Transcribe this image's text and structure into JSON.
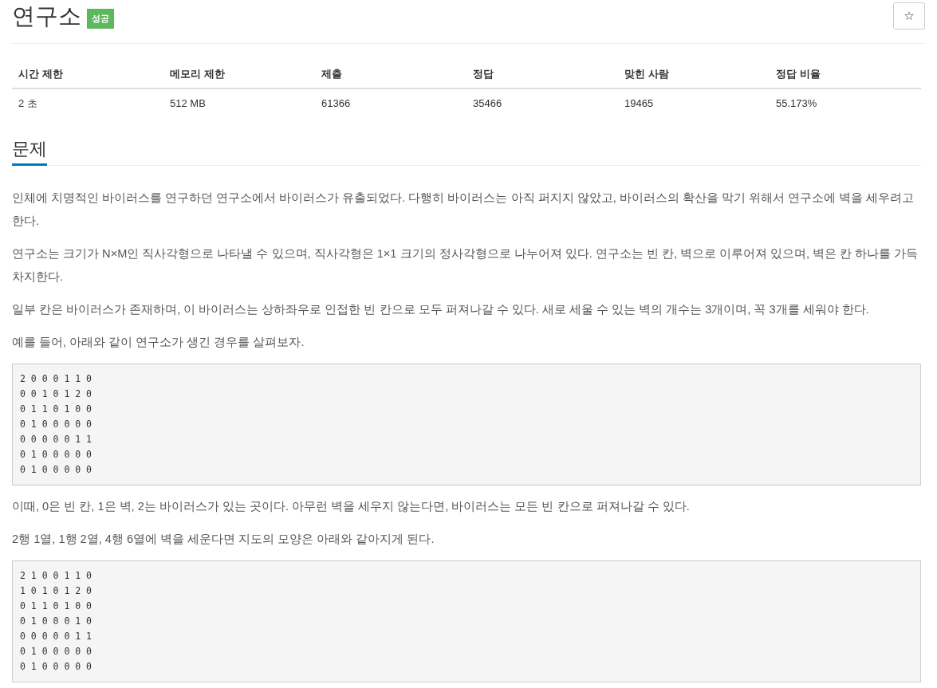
{
  "title": "연구소",
  "badge": "성공",
  "star_button": "☆",
  "info_table": {
    "columns": [
      "시간 제한",
      "메모리 제한",
      "제출",
      "정답",
      "맞힌 사람",
      "정답 비율"
    ],
    "rows": [
      [
        "2 초",
        "512 MB",
        "61366",
        "35466",
        "19465",
        "55.173%"
      ]
    ]
  },
  "section": {
    "heading": "문제",
    "blocks": [
      {
        "kind": "paragraph",
        "text": "인체에 치명적인 바이러스를 연구하던 연구소에서 바이러스가 유출되었다. 다행히 바이러스는 아직 퍼지지 않았고, 바이러스의 확산을 막기 위해서 연구소에 벽을 세우려고 한다."
      },
      {
        "kind": "paragraph",
        "text": "연구소는 크기가 N×M인 직사각형으로 나타낼 수 있으며, 직사각형은 1×1 크기의 정사각형으로 나누어져 있다. 연구소는 빈 칸, 벽으로 이루어져 있으며, 벽은 칸 하나를 가득 차지한다."
      },
      {
        "kind": "paragraph",
        "text": "일부 칸은 바이러스가 존재하며, 이 바이러스는 상하좌우로 인접한 빈 칸으로 모두 퍼져나갈 수 있다. 새로 세울 수 있는 벽의 개수는 3개이며, 꼭 3개를 세워야 한다."
      },
      {
        "kind": "paragraph",
        "text": "예를 들어, 아래와 같이 연구소가 생긴 경우를 살펴보자."
      },
      {
        "kind": "code",
        "lines": [
          "2 0 0 0 1 1 0",
          "0 0 1 0 1 2 0",
          "0 1 1 0 1 0 0",
          "0 1 0 0 0 0 0",
          "0 0 0 0 0 1 1",
          "0 1 0 0 0 0 0",
          "0 1 0 0 0 0 0"
        ]
      },
      {
        "kind": "paragraph",
        "text": "이때, 0은 빈 칸, 1은 벽, 2는 바이러스가 있는 곳이다. 아무런 벽을 세우지 않는다면, 바이러스는 모든 빈 칸으로 퍼져나갈 수 있다."
      },
      {
        "kind": "paragraph",
        "text": "2행 1열, 1행 2열, 4행 6열에 벽을 세운다면 지도의 모양은 아래와 같아지게 된다."
      },
      {
        "kind": "code",
        "lines": [
          "2 1 0 0 1 1 0",
          "1 0 1 0 1 2 0",
          "0 1 1 0 1 0 0",
          "0 1 0 0 0 1 0",
          "0 0 0 0 0 1 1",
          "0 1 0 0 0 0 0",
          "0 1 0 0 0 0 0"
        ]
      }
    ]
  }
}
